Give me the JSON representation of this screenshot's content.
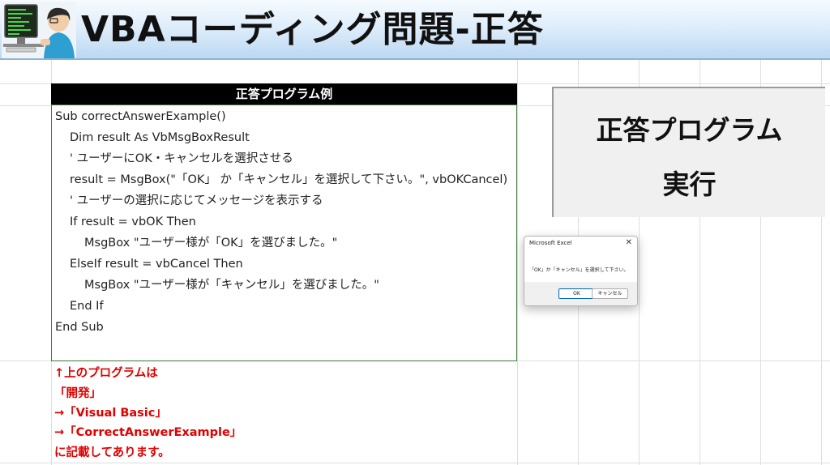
{
  "header": {
    "title": "VBAコーディング問題-正答"
  },
  "code_panel": {
    "header": "正答プログラム例",
    "lines": [
      "Sub correctAnswerExample()",
      "Dim result As VbMsgBoxResult",
      "' ユーザーにOK・キャンセルを選択させる",
      "result = MsgBox(\"「OK」 か「キャンセル」を選択して下さい。\", vbOKCancel)",
      "' ユーザーの選択に応じてメッセージを表示する",
      "If result = vbOK Then",
      "MsgBox \"ユーザー様が「OK」を選びました。\"",
      "ElseIf result = vbCancel Then",
      "MsgBox \"ユーザー様が「キャンセル」を選びました。\"",
      "End If",
      "End Sub"
    ]
  },
  "run_button": {
    "line1": "正答プログラム",
    "line2": "実行"
  },
  "dialog": {
    "title": "Microsoft Excel",
    "close": "✕",
    "message": "「OK」か「キャンセル」を選択して下さい。",
    "ok_label": "OK",
    "cancel_label": "キャンセル"
  },
  "note": {
    "lines": [
      "↑上のプログラムは",
      "「開発」",
      "→「Visual Basic」",
      "→「CorrectAnswerExample」",
      "に記載してあります。"
    ]
  }
}
